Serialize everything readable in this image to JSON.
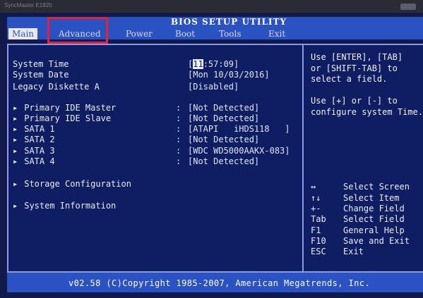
{
  "bezel": {
    "brand": "SyncMaster E1920"
  },
  "title": "BIOS SETUP UTILITY",
  "tabs": [
    {
      "label": "Main"
    },
    {
      "label": "Advanced"
    },
    {
      "label": "Power"
    },
    {
      "label": "Boot"
    },
    {
      "label": "Tools"
    },
    {
      "label": "Exit"
    }
  ],
  "system": {
    "time_label": "System Time",
    "time_value_prefix": "[",
    "time_value_highlight": "11",
    "time_value_rest": ":57:09]",
    "date_label": "System Date",
    "date_value": "[Mon 10/03/2016]",
    "diskette_label": "Legacy Diskette A",
    "diskette_value": "[Disabled]"
  },
  "drives": [
    {
      "label": "Primary IDE Master",
      "value": "[Not Detected]"
    },
    {
      "label": "Primary IDE Slave",
      "value": "[Not Detected]"
    },
    {
      "label": "SATA 1",
      "value": "[ATAPI   iHDS118   ]"
    },
    {
      "label": "SATA 2",
      "value": "[Not Detected]"
    },
    {
      "label": "SATA 3",
      "value": "[WDC WD5000AAKX-083]"
    },
    {
      "label": "SATA 4",
      "value": "[Not Detected]"
    }
  ],
  "submenus": [
    {
      "label": "Storage Configuration"
    },
    {
      "label": "System Information"
    }
  ],
  "help": {
    "line1": "Use [ENTER], [TAB]",
    "line2": "or [SHIFT-TAB] to",
    "line3": "select a field.",
    "line4": "Use [+] or [-] to",
    "line5": "configure system Time."
  },
  "keys": [
    {
      "key": "↔",
      "desc": "Select Screen"
    },
    {
      "key": "↑↓",
      "desc": "Select Item"
    },
    {
      "key": "+-",
      "desc": "Change Field"
    },
    {
      "key": "Tab",
      "desc": "Select Field"
    },
    {
      "key": "F1",
      "desc": "General Help"
    },
    {
      "key": "F10",
      "desc": "Save and Exit"
    },
    {
      "key": "ESC",
      "desc": "Exit"
    }
  ],
  "footer": "v02.58 (C)Copyright 1985-2007, American Megatrends, Inc.",
  "colors": {
    "background": "#0f1d62",
    "bar": "#2a52c2",
    "text": "#e9edf9",
    "annotation_box": "#e4203a"
  }
}
